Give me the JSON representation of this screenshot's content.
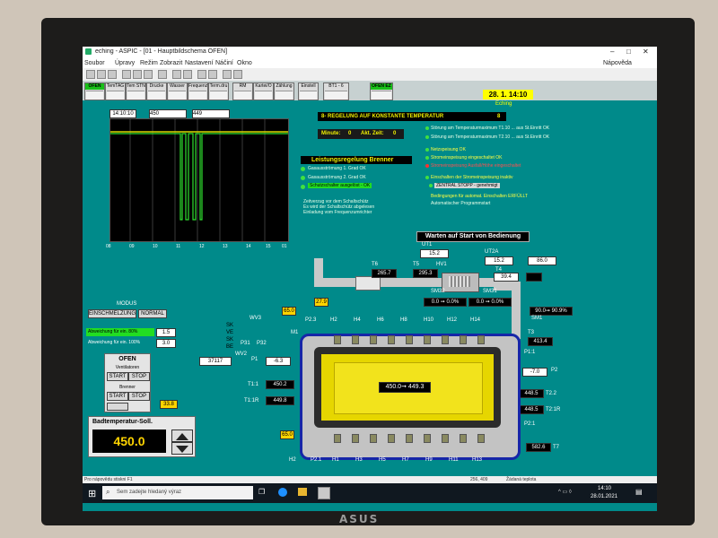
{
  "window": {
    "title": "eching - ASPIC - [01 - Hauptbildschema OFEN]",
    "help_label": "Nápověda",
    "menu": [
      "Soubor",
      "Úpravy",
      "Režim",
      "Zobrazit",
      "Nastavení",
      "Náčiní",
      "Okno"
    ]
  },
  "nav": {
    "buttons": [
      "OFEN",
      "TemTAG",
      "Tem STN",
      "Drucke",
      "Wasser",
      "Frequenz",
      "Term.dru",
      "RM",
      "Kartei/O",
      "Zählung",
      "Einstell",
      "BT1 - 6"
    ],
    "ofen_tag": "OFEN EZ",
    "date": "28. 1. 14:10",
    "location": "Eching"
  },
  "chart": {
    "header_time": "14:10:10",
    "header_v1": "450",
    "header_v2": "449",
    "ticks": [
      "08",
      "09",
      "10",
      "11",
      "12",
      "13",
      "14",
      "15",
      "01"
    ]
  },
  "regelung": {
    "title": "8- REGELUNG AUF KONSTANTE TEMPERATUR",
    "num": "8",
    "minute_label": "Minute:",
    "minute_value": "0",
    "akt_label": "Akt. Zeit:",
    "akt_value": "0"
  },
  "brenner": {
    "title": "Leistungsregelung Brenner",
    "items": [
      "Gasausströmung 1. Grad OK",
      "Gasausströmung 2. Grad OK",
      "Schutzschalter ausgelöst - OK"
    ],
    "note": [
      "Zeitverzug vor dem Schaltschütz",
      "Es wird der Schaltschütz abgelesen",
      "Einladung vom Frequenzumrichter"
    ]
  },
  "status": {
    "lines": [
      "Störung am Temperaturmaximum  T1.10 ... aus St.Einritt OK",
      "Störung am Temperaturmaximum  T2.10 ... aus St.Einritt OK",
      "Netzspeisung OK",
      "Stromeinspeisung eingeschaltet OK",
      "Stromeinspeisung Ausfall/Höhe eingeschaltet",
      "Einschalten der Stromeinspeisung inaktiv",
      "ZENTRAL STOPP - genehmigt",
      "Bedingungen für automat. Einschalten ERFÜLLT",
      "Automatischer Programmstart"
    ],
    "warten": "Warten auf Start von Bedienung"
  },
  "process": {
    "ut1": "UT1",
    "ut1_val": "15.2",
    "ut2a": "UT2A",
    "ut2a_val": "15.2",
    "ut2_val": "86.0",
    "t6": "T6",
    "t6_val": "265.7",
    "t5": "T5",
    "t5_val": "295.3",
    "hv1": "HV1",
    "t4": "T4",
    "t4_val": "39.4",
    "sm32": "SM32",
    "sm31": "SM31",
    "sm1": "SM1",
    "f1": "0.0 ➞ 0.0%",
    "f2": "0.0 ➞ 0.0%",
    "t3a": "90.0➞ 90.9%",
    "t3": "T3",
    "t3_val": "413.4",
    "p2": "P2",
    "p2_val": "-7.0",
    "p11": "P1:1",
    "t22": "T2.2",
    "t22_val": "448.5",
    "t21r": "T2:1R",
    "t21r_val": "448.5",
    "p21": "P2:1",
    "t7": "T7",
    "t7_val": "582.6",
    "t11": "T1:1",
    "t11_val": "450.2",
    "t11r": "T1:1R",
    "t11r_val": "449.8",
    "p1": "P1",
    "p1_val": "-6.3",
    "p31": "P31",
    "p32": "P32",
    "counter": "37117",
    "m1": "M1",
    "ofen_setpoint": "450.0➞ 449.3",
    "v65a": "65.0",
    "v279": "27.9",
    "v65b": "65.0",
    "h_top": [
      "P2.3",
      "H2",
      "H4",
      "H6",
      "H8",
      "H10",
      "H12",
      "H14"
    ],
    "h_bot": [
      "H2",
      "P2.1",
      "H1",
      "H3",
      "H5",
      "H7",
      "H9",
      "H11",
      "H13"
    ],
    "wv3": "WV3",
    "wv2": "WV2",
    "left_labels": [
      "SK",
      "VE",
      "SK",
      "BE"
    ],
    "dpl_val": "33.8"
  },
  "controls": {
    "modus": "MODUS",
    "einschmelzung": "EINSCHMELZUNG",
    "normal": "NORMAL",
    "abw1_label": "Abweichung für ein. 80%",
    "abw1_val": "1.5",
    "abw2_label": "Abweichung für ein. 100%",
    "abw2_val": "3.0",
    "ofen_title": "OFEN",
    "ventilatoren": "Ventilatoren",
    "brenner": "Brenner",
    "start": "START",
    "stop": "STOP",
    "bad_title": "Badtemperatur-Soll.",
    "bad_value": "450.0"
  },
  "statusbar": {
    "left": "Pro nápovědu stiskni F1",
    "coords": "256, 409",
    "right": "Žádaná teplota"
  },
  "taskbar": {
    "search": "Sem zadejte hledaný výraz",
    "time": "14:10",
    "date": "28.01.2021"
  }
}
